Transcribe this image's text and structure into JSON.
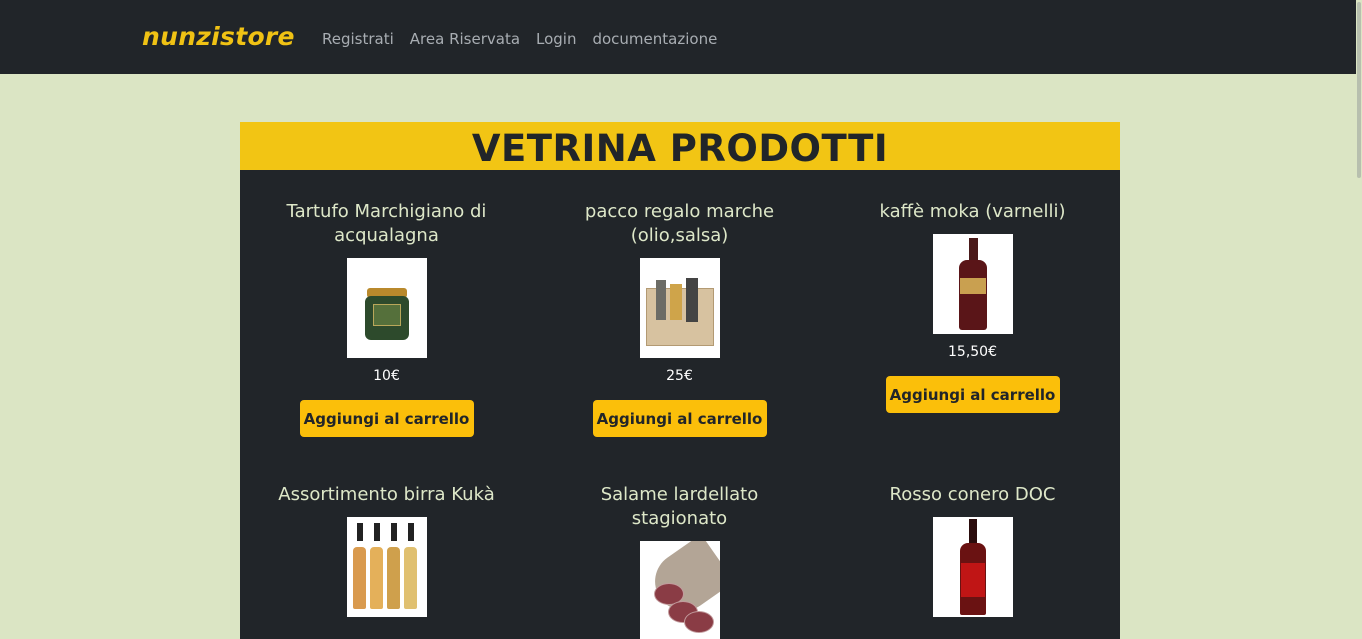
{
  "brand": "nunzistore",
  "nav": {
    "items": [
      "Registrati",
      "Area Riservata",
      "Login",
      "documentazione"
    ]
  },
  "showcase": {
    "title": "VETRINA PRODOTTI"
  },
  "products": [
    {
      "name": "Tartufo Marchigiano di acqualagna",
      "price": "10€",
      "button": "Aggiungi al carrello",
      "image": "truffle-jar-image"
    },
    {
      "name": "pacco regalo marche (olio,salsa)",
      "price": "25€",
      "button": "Aggiungi al carrello",
      "image": "gift-box-image"
    },
    {
      "name": "kaffè moka (varnelli)",
      "price": "15,50€",
      "button": "Aggiungi al carrello",
      "image": "liqueur-bottle-image"
    },
    {
      "name": "Assortimento birra Kukà",
      "image": "beer-bottles-image"
    },
    {
      "name": "Salame lardellato stagionato",
      "image": "salami-image"
    },
    {
      "name": "Rosso conero DOC",
      "image": "wine-bottle-image"
    }
  ],
  "colors": {
    "navbar": "#212529",
    "brand": "#f0c214",
    "page_background": "#dbe5c4",
    "header_band": "#f2c514",
    "button": "#fbbf0a"
  }
}
